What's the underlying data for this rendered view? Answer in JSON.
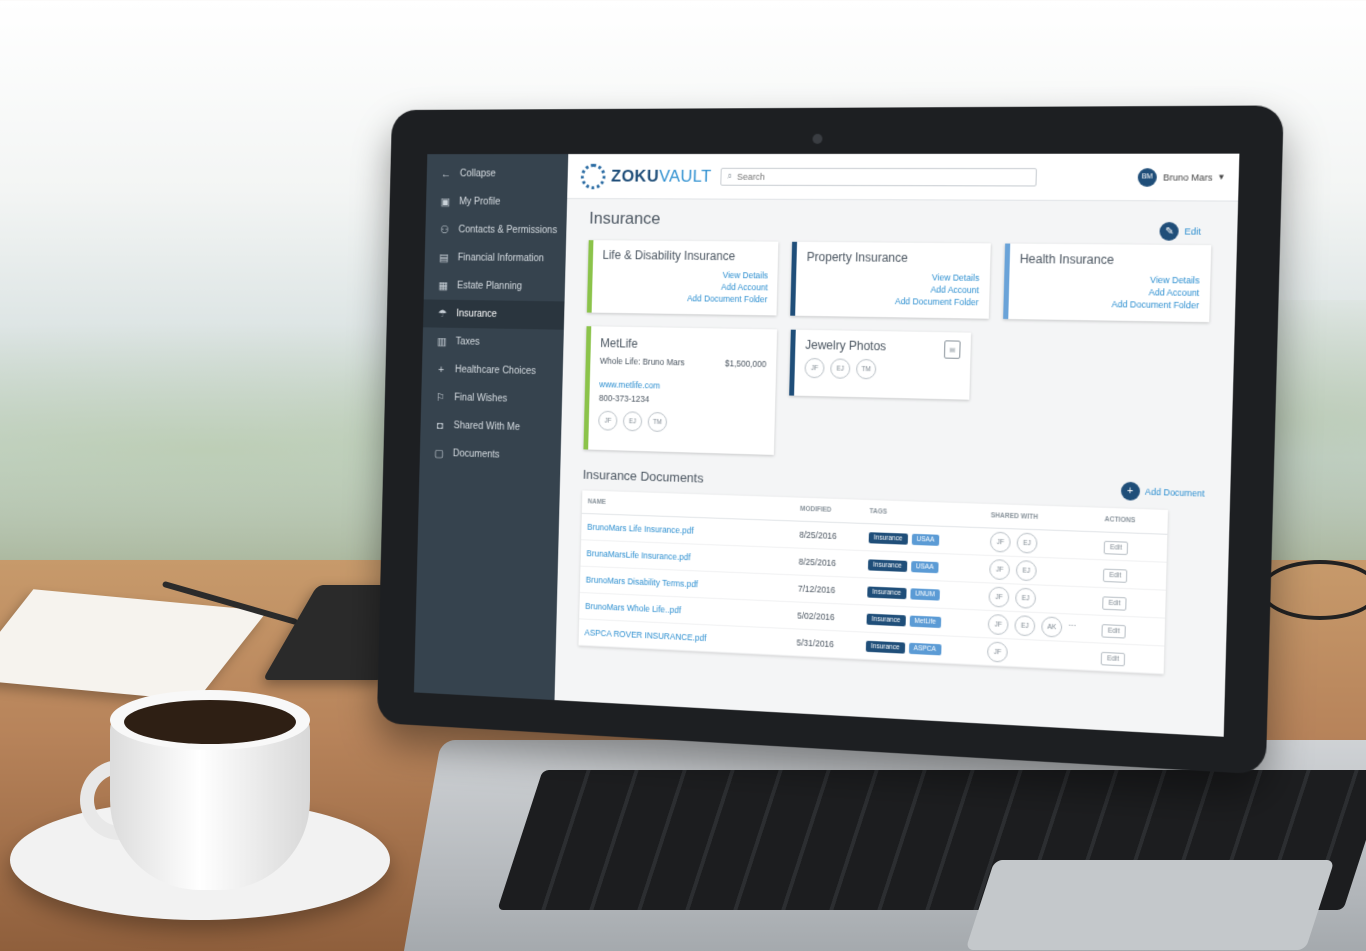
{
  "sidebar": {
    "collapse_label": "Collapse",
    "items": [
      {
        "label": "My Profile",
        "icon": "profile-icon"
      },
      {
        "label": "Contacts & Permissions",
        "icon": "contacts-icon"
      },
      {
        "label": "Financial Information",
        "icon": "chart-icon"
      },
      {
        "label": "Estate Planning",
        "icon": "document-icon"
      },
      {
        "label": "Insurance",
        "icon": "umbrella-icon"
      },
      {
        "label": "Taxes",
        "icon": "tax-icon"
      },
      {
        "label": "Healthcare Choices",
        "icon": "plus-icon"
      },
      {
        "label": "Final Wishes",
        "icon": "bookmark-icon"
      },
      {
        "label": "Shared With Me",
        "icon": "shared-icon"
      },
      {
        "label": "Documents",
        "icon": "folder-icon"
      }
    ],
    "active_index": 4
  },
  "header": {
    "logo_bold": "ZOKU",
    "logo_light": "VAULT",
    "search_placeholder": "Search",
    "user_initials": "BM",
    "user_name": "Bruno Mars"
  },
  "page": {
    "title": "Insurance",
    "edit_label": "Edit"
  },
  "categories": [
    {
      "title": "Life & Disability Insurance",
      "links": [
        "View Details",
        "Add Account",
        "Add Document Folder"
      ]
    },
    {
      "title": "Property Insurance",
      "links": [
        "View Details",
        "Add Account",
        "Add Document Folder"
      ]
    },
    {
      "title": "Health Insurance",
      "links": [
        "View Details",
        "Add Account",
        "Add Document Folder"
      ]
    }
  ],
  "account_card": {
    "name": "MetLife",
    "policy": "Whole Life: Bruno Mars",
    "amount": "$1,500,000",
    "url": "www.metlife.com",
    "phone": "800-373-1234",
    "shared": [
      "JF",
      "EJ",
      "TM"
    ]
  },
  "folder_card": {
    "name": "Jewelry Photos",
    "shared": [
      "JF",
      "EJ",
      "TM"
    ]
  },
  "documents": {
    "title": "Insurance Documents",
    "add_label": "Add Document",
    "columns": [
      "Name",
      "Modified",
      "Tags",
      "Shared With",
      "Actions"
    ],
    "rows": [
      {
        "name": "BrunoMars Life Insurance.pdf",
        "modified": "8/25/2016",
        "tags": [
          "Insurance",
          "USAA"
        ],
        "shared": [
          "JF",
          "EJ"
        ],
        "action": "Edit"
      },
      {
        "name": "BrunaMarsLife Insurance.pdf",
        "modified": "8/25/2016",
        "tags": [
          "Insurance",
          "USAA"
        ],
        "shared": [
          "JF",
          "EJ"
        ],
        "action": "Edit"
      },
      {
        "name": "BrunoMars Disability Terms.pdf",
        "modified": "7/12/2016",
        "tags": [
          "Insurance",
          "UNUM"
        ],
        "shared": [
          "JF",
          "EJ"
        ],
        "action": "Edit"
      },
      {
        "name": "BrunoMars Whole Life..pdf",
        "modified": "5/02/2016",
        "tags": [
          "Insurance",
          "MetLife"
        ],
        "shared": [
          "JF",
          "EJ",
          "AK"
        ],
        "more": "...",
        "action": "Edit"
      },
      {
        "name": "ASPCA ROVER INSURANCE.pdf",
        "modified": "5/31/2016",
        "tags": [
          "Insurance",
          "ASPCA"
        ],
        "shared": [
          "JF"
        ],
        "action": "Edit"
      }
    ]
  },
  "colors": {
    "sidebar_bg": "#36434e",
    "brand_navy": "#1f4e79",
    "link_blue": "#2d8fd0",
    "accent_green": "#8bc34a"
  }
}
